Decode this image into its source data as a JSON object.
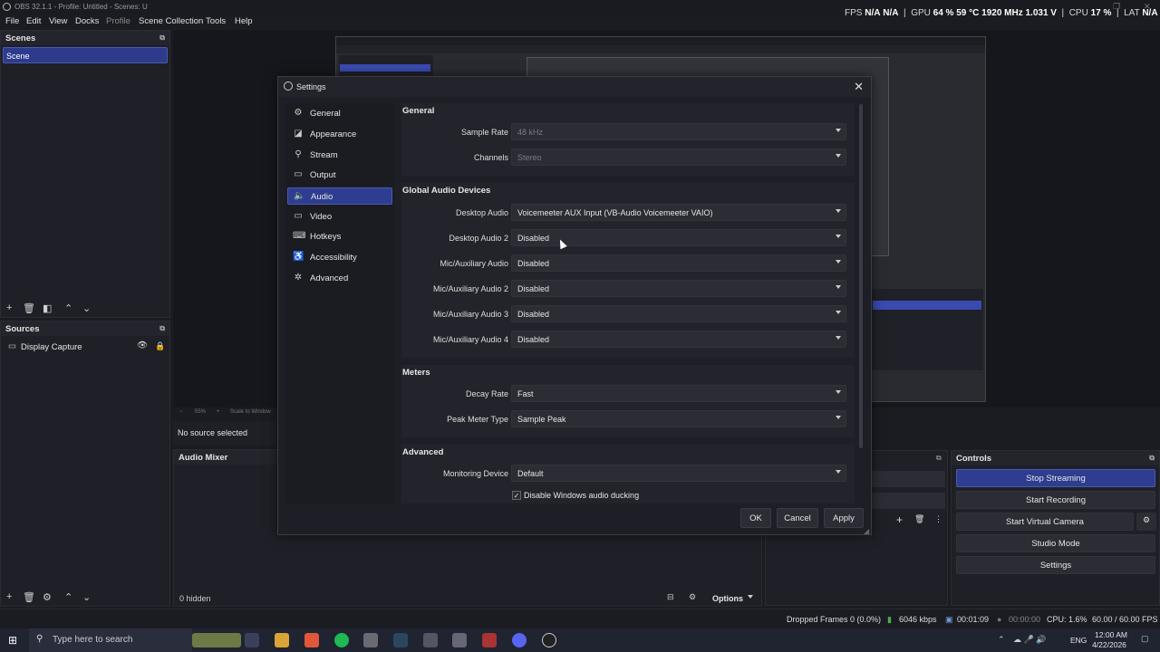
{
  "window": {
    "title": "OBS 32.1.1 - Profile: Untitled - Scenes: U"
  },
  "menu": [
    "File",
    "Edit",
    "View",
    "Docks",
    "Profile",
    "Scene Collection",
    "Tools",
    "Help"
  ],
  "stats": {
    "fps_label": "FPS",
    "fps1": "N/A",
    "fps2": "N/A",
    "gpu_label": "GPU",
    "gpu_pct": "64 %",
    "gpu_temp": "59 °C",
    "gpu_clock": "1920 MHz",
    "gpu_volt": "1.031 V",
    "cpu_label": "CPU",
    "cpu_pct": "17 %",
    "lat_label": "LAT",
    "lat": "N/A"
  },
  "scenes": {
    "title": "Scenes",
    "items": [
      "Scene"
    ]
  },
  "sources": {
    "title": "Sources",
    "items": [
      "Display Capture"
    ],
    "no_source": "No source selected",
    "hidden_count": "0 hidden"
  },
  "zoom": {
    "pct": "55%",
    "fit": "Scale to Window"
  },
  "audio_mixer": {
    "title": "Audio Mixer"
  },
  "options_label": "Options",
  "controls": {
    "title": "Controls",
    "buttons": [
      "Stop Streaming",
      "Start Recording",
      "Start Virtual Camera",
      "Studio Mode",
      "Settings"
    ]
  },
  "dialog": {
    "title": "Settings",
    "nav": [
      "General",
      "Appearance",
      "Stream",
      "Output",
      "Audio",
      "Video",
      "Hotkeys",
      "Accessibility",
      "Advanced"
    ],
    "active_nav": "Audio",
    "general": {
      "title": "General",
      "rows": [
        {
          "label": "Sample Rate",
          "value": "48 kHz"
        },
        {
          "label": "Channels",
          "value": "Stereo"
        }
      ]
    },
    "devices": {
      "title": "Global Audio Devices",
      "rows": [
        {
          "label": "Desktop Audio",
          "value": "Voicemeeter AUX Input (VB-Audio Voicemeeter VAIO)"
        },
        {
          "label": "Desktop Audio 2",
          "value": "Disabled"
        },
        {
          "label": "Mic/Auxiliary Audio",
          "value": "Disabled"
        },
        {
          "label": "Mic/Auxiliary Audio 2",
          "value": "Disabled"
        },
        {
          "label": "Mic/Auxiliary Audio 3",
          "value": "Disabled"
        },
        {
          "label": "Mic/Auxiliary Audio 4",
          "value": "Disabled"
        }
      ]
    },
    "meters": {
      "title": "Meters",
      "rows": [
        {
          "label": "Decay Rate",
          "value": "Fast"
        },
        {
          "label": "Peak Meter Type",
          "value": "Sample Peak"
        }
      ]
    },
    "advanced": {
      "title": "Advanced",
      "monitoring_label": "Monitoring Device",
      "monitoring_value": "Default",
      "ducking_label": "Disable Windows audio ducking",
      "ducking_checked": true
    },
    "buttons": {
      "ok": "OK",
      "cancel": "Cancel",
      "apply": "Apply"
    }
  },
  "status": {
    "dropped": "Dropped Frames 0 (0.0%)",
    "bitrate": "6046 kbps",
    "stream_time": "00:01:09",
    "rec_time": "00:00:00",
    "cpu": "CPU: 1.6%",
    "fps": "60.00 / 60.00 FPS"
  },
  "taskbar": {
    "search_placeholder": "Type here to search",
    "lang": "ENG",
    "time": "12:00 AM",
    "date": "4/22/2026"
  }
}
